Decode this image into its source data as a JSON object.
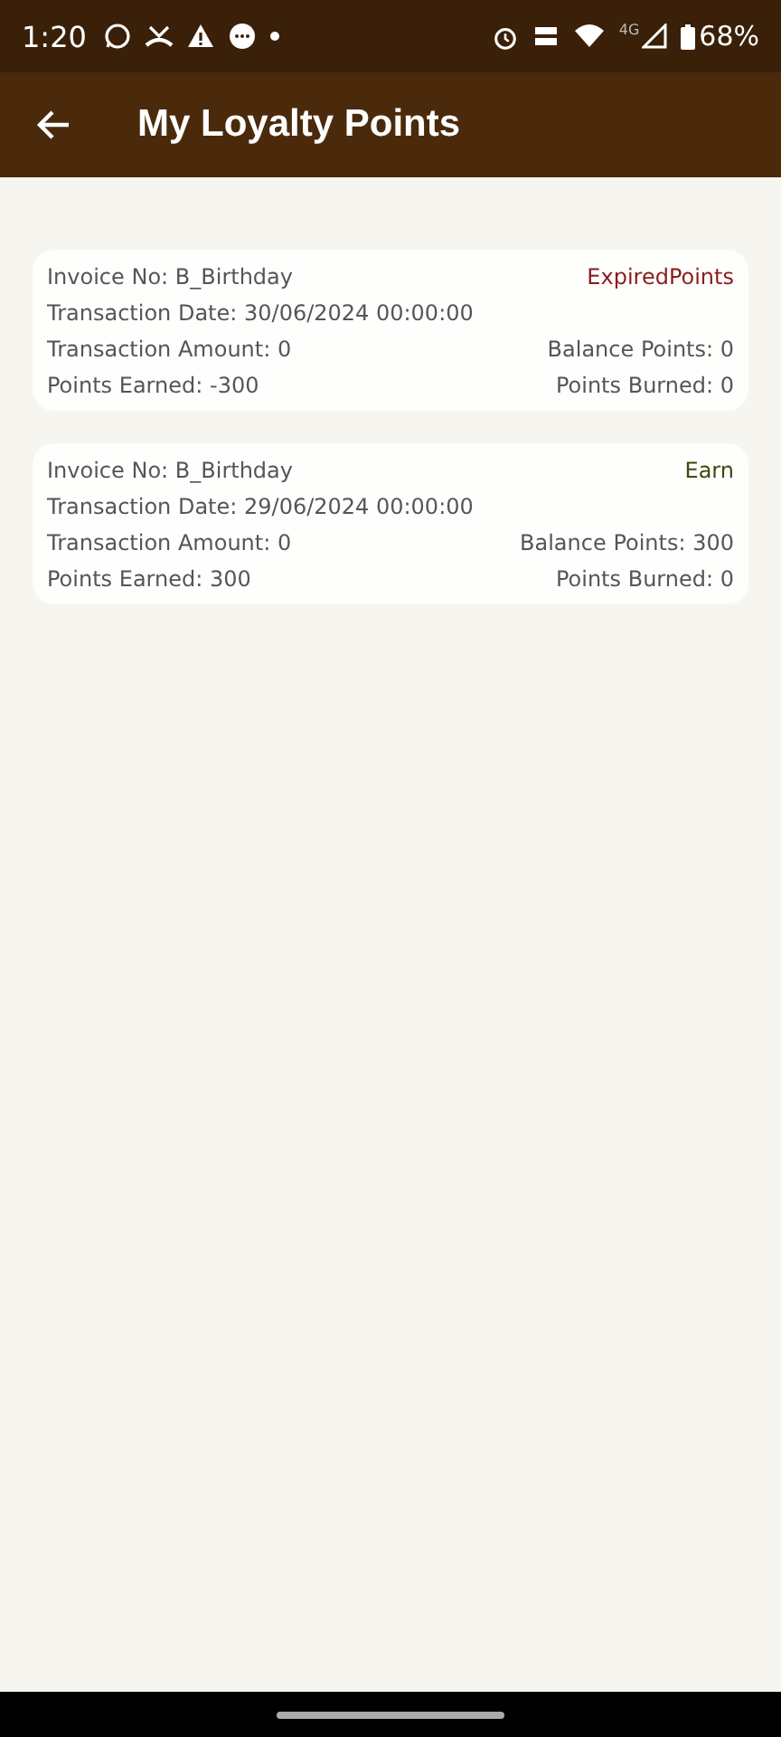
{
  "status_bar": {
    "time": "1:20",
    "network": "4G",
    "battery": "68%"
  },
  "app_bar": {
    "title": "My Loyalty Points"
  },
  "transactions": [
    {
      "invoice": "Invoice No: B_Birthday",
      "type": "ExpiredPoints",
      "color": "#8b1a1a",
      "date": "Transaction Date: 30/06/2024 00:00:00",
      "amount": "Transaction Amount: 0",
      "balance": "Balance Points: 0",
      "earned": "Points Earned: -300",
      "burned": "Points Burned: 0"
    },
    {
      "invoice": "Invoice No: B_Birthday",
      "type": "Earn",
      "color": "#3d4a10",
      "date": "Transaction Date: 29/06/2024 00:00:00",
      "amount": "Transaction Amount: 0",
      "balance": "Balance Points: 300",
      "earned": "Points Earned: 300",
      "burned": "Points Burned: 0"
    }
  ]
}
